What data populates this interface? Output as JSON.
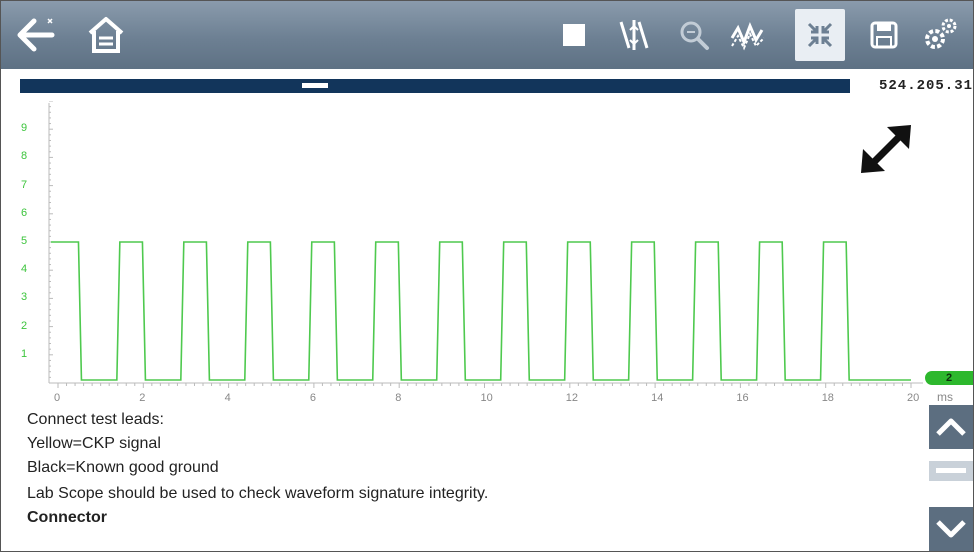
{
  "toolbar": {
    "icons": [
      "back-arrow-icon",
      "home-icon",
      "stop-icon",
      "split-icon",
      "zoom-icon",
      "waveform-icon",
      "collapse-icon",
      "save-icon",
      "settings-icon"
    ]
  },
  "scroll": {
    "position_readout": "524.205.31",
    "thumb_fraction": 0.34
  },
  "chart_data": {
    "type": "line",
    "xlabel": "ms",
    "ylabel": "",
    "xlim": [
      0,
      20
    ],
    "ylim": [
      0,
      10
    ],
    "x_ticks": [
      "0",
      "2",
      "4",
      "6",
      "8",
      "10",
      "12",
      "14",
      "16",
      "18",
      "20"
    ],
    "y_ticks": [
      "1",
      "2",
      "3",
      "4",
      "5",
      "6",
      "7",
      "8",
      "9"
    ],
    "series": [
      {
        "color": "#4ec94e",
        "high": 5,
        "low": 0,
        "rising_edges": [
          0.0,
          1.45,
          2.95,
          4.45,
          5.95,
          7.45,
          8.95,
          10.45,
          11.95,
          13.45,
          14.95,
          16.45,
          17.95
        ],
        "falling_edges": [
          0.55,
          2.05,
          3.55,
          5.05,
          6.55,
          8.05,
          9.55,
          11.05,
          12.55,
          14.05,
          15.55,
          17.05,
          18.55
        ],
        "x": [
          0,
          0.55,
          1.45,
          2.05,
          2.95,
          3.55,
          4.45,
          5.05,
          5.95,
          6.55,
          7.45,
          8.05,
          8.95,
          9.55,
          10.45,
          11.05,
          11.95,
          12.55,
          13.45,
          14.05,
          14.95,
          15.55,
          16.45,
          17.05,
          17.95,
          18.55,
          20
        ],
        "y": [
          5,
          0,
          5,
          0,
          5,
          0,
          5,
          0,
          5,
          0,
          5,
          0,
          5,
          0,
          5,
          0,
          5,
          0,
          5,
          0,
          5,
          0,
          5,
          0,
          5,
          0,
          0
        ]
      }
    ],
    "channel_badge": "2",
    "grid": false
  },
  "info": {
    "lines": [
      "Connect test leads:",
      "Yellow=CKP signal",
      "Black=Known good ground",
      "Lab Scope should be used to check waveform signature integrity."
    ],
    "title": "Connector"
  }
}
